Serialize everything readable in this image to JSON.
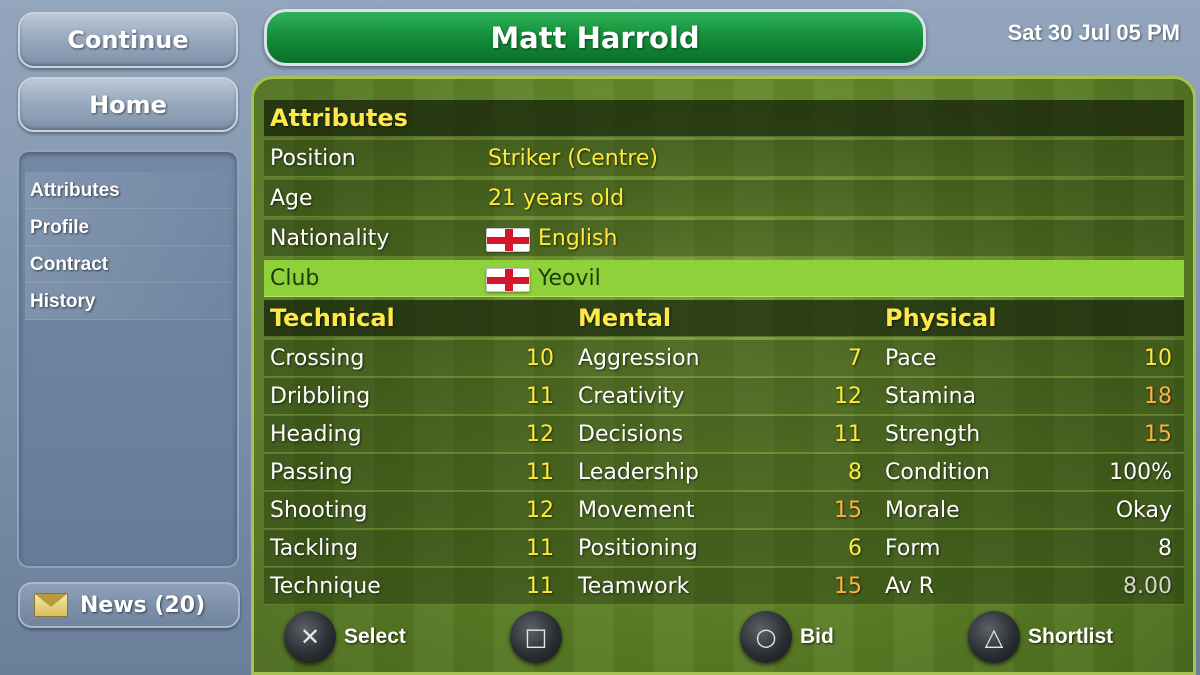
{
  "sidebar": {
    "continue_label": "Continue",
    "home_label": "Home",
    "items": [
      "Attributes",
      "Profile",
      "Contract",
      "History"
    ],
    "news_label": "News (20)"
  },
  "header": {
    "player_name": "Matt Harrold",
    "date": "Sat 30 Jul 05 PM"
  },
  "attributes": {
    "title": "Attributes",
    "position_label": "Position",
    "position_value": "Striker (Centre)",
    "age_label": "Age",
    "age_value": "21 years old",
    "nationality_label": "Nationality",
    "nationality_value": "English",
    "club_label": "Club",
    "club_value": "Yeovil"
  },
  "technical": {
    "title": "Technical",
    "rows": [
      {
        "label": "Crossing",
        "value": "10"
      },
      {
        "label": "Dribbling",
        "value": "11"
      },
      {
        "label": "Heading",
        "value": "12"
      },
      {
        "label": "Passing",
        "value": "11"
      },
      {
        "label": "Shooting",
        "value": "12"
      },
      {
        "label": "Tackling",
        "value": "11"
      },
      {
        "label": "Technique",
        "value": "11"
      }
    ]
  },
  "mental": {
    "title": "Mental",
    "rows": [
      {
        "label": "Aggression",
        "value": "7"
      },
      {
        "label": "Creativity",
        "value": "12"
      },
      {
        "label": "Decisions",
        "value": "11"
      },
      {
        "label": "Leadership",
        "value": "8"
      },
      {
        "label": "Movement",
        "value": "15"
      },
      {
        "label": "Positioning",
        "value": "6"
      },
      {
        "label": "Teamwork",
        "value": "15"
      }
    ]
  },
  "physical": {
    "title": "Physical",
    "rows": [
      {
        "label": "Pace",
        "value": "10"
      },
      {
        "label": "Stamina",
        "value": "18"
      },
      {
        "label": "Strength",
        "value": "15"
      },
      {
        "label": "Condition",
        "value": "100%"
      },
      {
        "label": "Morale",
        "value": "Okay"
      },
      {
        "label": "Form",
        "value": "8"
      },
      {
        "label": "Av R",
        "value": "8.00"
      }
    ]
  },
  "controls": {
    "cross_label": "Select",
    "square_label": "",
    "circle_label": "Bid",
    "triangle_label": "Shortlist",
    "cross_glyph": "✕",
    "square_glyph": "□",
    "circle_glyph": "○",
    "triangle_glyph": "△"
  },
  "colors": {
    "header_green": "#138d3a",
    "value_yellow": "#ffea3a",
    "value_orange": "#ffb33a",
    "highlight_green": "#8fd13a",
    "sidebar_blue": "#7c90aa"
  }
}
